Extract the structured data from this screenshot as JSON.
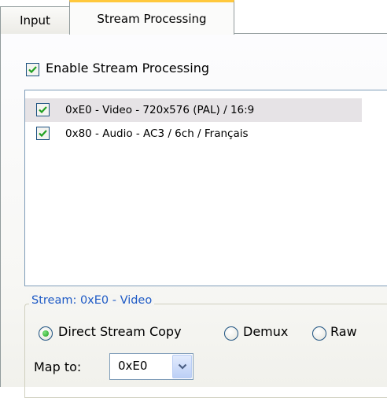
{
  "tabs": [
    {
      "label": "Input",
      "active": false
    },
    {
      "label": "Stream Processing",
      "active": true
    }
  ],
  "enable_processing": {
    "label": "Enable Stream Processing",
    "checked": true
  },
  "streams": [
    {
      "label": "0xE0 - Video - 720x576 (PAL) / 16:9",
      "checked": true,
      "selected": true
    },
    {
      "label": "0x80 - Audio - AC3 / 6ch / Français",
      "checked": true,
      "selected": false
    }
  ],
  "stream_group": {
    "title": "Stream: 0xE0 - Video",
    "modes": [
      {
        "label": "Direct Stream Copy",
        "selected": true
      },
      {
        "label": "Demux",
        "selected": false
      },
      {
        "label": "Raw",
        "selected": false
      }
    ],
    "map_to": {
      "label": "Map to:",
      "value": "0xE0"
    }
  },
  "colors": {
    "accent_tab": "#ffc83c",
    "group_title": "#1f5bc6",
    "check": "#21a121"
  }
}
